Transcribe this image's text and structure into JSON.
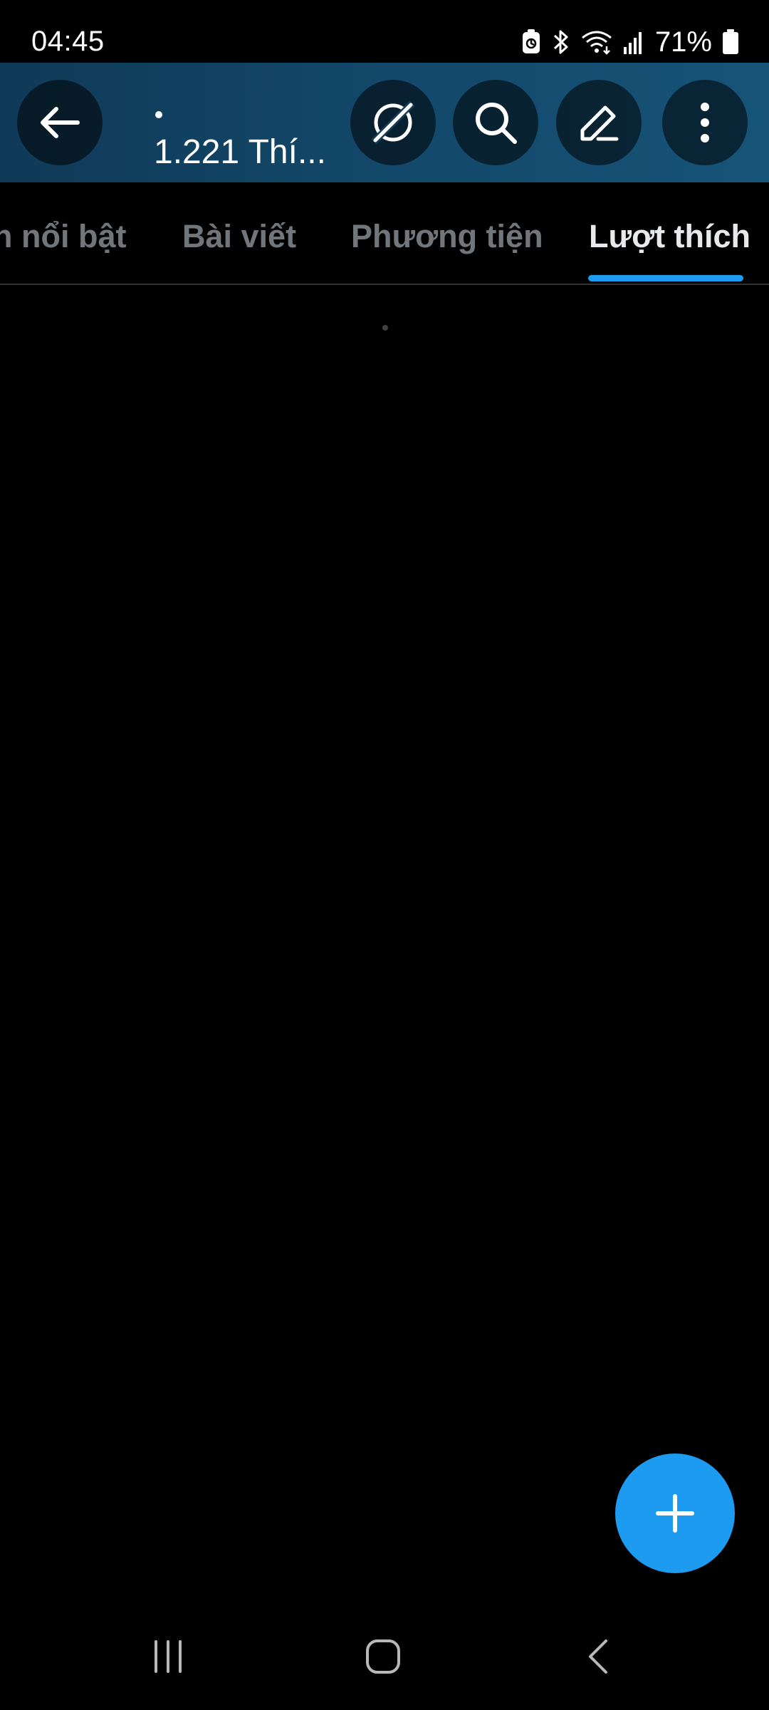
{
  "status_bar": {
    "time": "04:45",
    "battery_percent": "71%",
    "icons": [
      "battery-saver-icon",
      "bluetooth-icon",
      "wifi-icon",
      "signal-icon",
      "battery-icon"
    ]
  },
  "header": {
    "title": "•",
    "subtitle": "1.221 Thí...",
    "buttons": [
      "back-arrow-icon",
      "grok-icon",
      "search-icon",
      "edit-icon",
      "more-vertical-icon"
    ]
  },
  "tabs": [
    {
      "label": "n nổi bật",
      "active": false
    },
    {
      "label": "Bài viết",
      "active": false
    },
    {
      "label": "Phương tiện",
      "active": false
    },
    {
      "label": "Lượt thích",
      "active": true
    }
  ],
  "fab": {
    "icon": "plus-icon"
  },
  "nav_bar": {
    "buttons": [
      "recents-icon",
      "home-icon",
      "back-icon"
    ]
  },
  "colors": {
    "accent": "#1d9bf0",
    "header_bg": "#13496b",
    "background": "#000000",
    "tab_inactive": "#71767b",
    "tab_active": "#e7e9ea"
  }
}
